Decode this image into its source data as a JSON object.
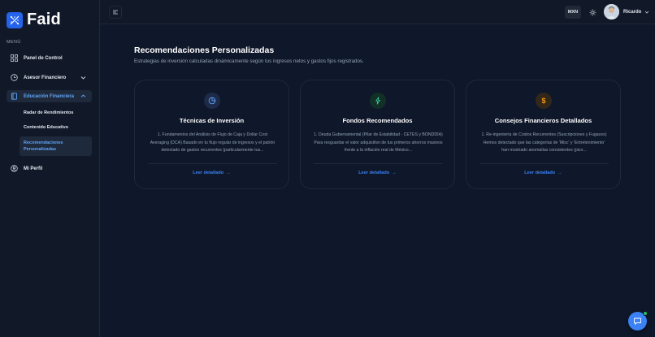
{
  "app": {
    "name": "Faid"
  },
  "sidebar": {
    "menu_label": "MENÚ",
    "items": [
      {
        "label": "Panel de Control",
        "icon": "grid-icon"
      },
      {
        "label": "Asesor Financiero",
        "icon": "clock-icon"
      },
      {
        "label": "Educación Financiera",
        "icon": "book-icon"
      },
      {
        "label": "Mi Perfil",
        "icon": "user-circle-icon"
      }
    ],
    "sub_items": [
      {
        "label": "Radar de Rendimientos"
      },
      {
        "label": "Contenido Educativo"
      },
      {
        "label": "Recomendaciones Personalizadas"
      }
    ]
  },
  "header": {
    "currency": "MXN",
    "user_name": "Ricardo"
  },
  "main": {
    "title": "Recomendaciones Personalizadas",
    "subtitle": "Estrategias de inversión calculadas dinámicamente según tus ingresos netos y gastos fijos registrados.",
    "cards": [
      {
        "title": "Técnicas de Inversión",
        "body": "1. Fundamentos del Análisis de Flujo de Caja y Dollar Cost Averaging (DCA) Basado en tu flujo regular de ingresos y el patrón detectado de gastos recurrentes (particularmente tus...",
        "link": "Leer detallado",
        "icon": "pie-chart-icon"
      },
      {
        "title": "Fondos Recomendados",
        "body": "1. Deuda Gubernamental (Pilar de Estabilidad - CETES y BONDDIA) Para resguardar el valor adquisitivo de tus primeros ahorros masivos frente a la inflación real de México...",
        "link": "Leer detallado",
        "icon": "lightning-icon"
      },
      {
        "title": "Consejos Financieros Detallados",
        "body": "1. Re-ingeniería de Costos Recurrentes (Suscripciones y Fugaces) Hemos detectado que las categorías de 'Misc' y 'Entretenimiento' han mostrado anomalías consistentes (pico...",
        "link": "Leer detallado",
        "icon": "dollar-icon"
      }
    ]
  },
  "colors": {
    "accent": "#3b82f6",
    "icon_blue_bg": "#1e2a4a",
    "icon_green_bg": "#123027",
    "icon_amber_bg": "#33261a"
  }
}
